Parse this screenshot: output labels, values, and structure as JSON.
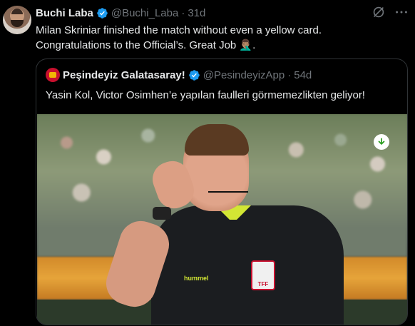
{
  "tweet": {
    "author_name": "Buchi Laba",
    "author_handle": "@Buchi_Laba",
    "separator": "·",
    "time": "31d",
    "text_line1": "Milan Skriniar finished the match without even a yellow card.",
    "text_line2": "Congratulations to the Official’s. Great Job 🤦🏽‍♂️."
  },
  "quoted": {
    "author_name": "Peşindeyiz Galatasaray!",
    "author_handle": "@PesindeyizApp",
    "separator": "·",
    "time": "54d",
    "text": "Yasin Kol, Victor Osimhen’e yapılan faulleri görmemezlikten geliyor!",
    "badge_text": "TFF",
    "kit_text": "hummel"
  },
  "colors": {
    "background": "#000000",
    "verified": "#1d9bf0",
    "secondary_text": "#71767b",
    "border": "#2f3336"
  },
  "icons": {
    "verified": "verified-badge-icon",
    "grok": "grok-icon",
    "more": "more-options-icon",
    "download": "download-icon"
  }
}
